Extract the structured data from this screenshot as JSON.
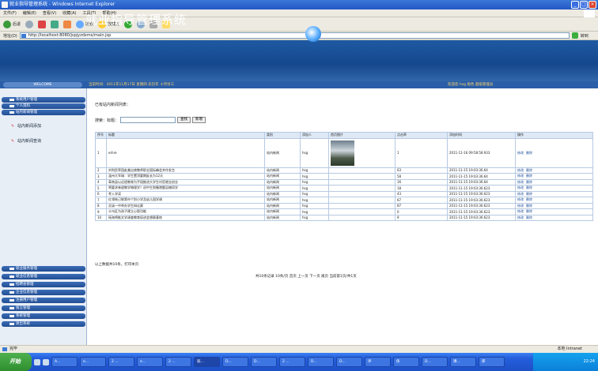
{
  "window": {
    "title": "就业指导管理系统 - Windows Internet Explorer"
  },
  "menu": [
    "文件(F)",
    "编辑(E)",
    "查看(V)",
    "收藏(A)",
    "工具(T)",
    "帮助(H)"
  ],
  "toolbar": {
    "back": "后退",
    "search": "搜索",
    "favorites": "收藏夹"
  },
  "address": {
    "label": "地址(D)",
    "url": "http://localhost:8080/jspjyzdxms/main.jsp",
    "go": "转到"
  },
  "banner": {
    "title": "就业指导管理系统"
  },
  "infobar": {
    "welcome": "WELCOME",
    "time": "当前时间：2011年11月17日 星期四 农历年 十月廿三",
    "user": "欢迎您 hsg 角色 超级管理员"
  },
  "sidebar": {
    "groups_top": [
      "系统用户管理",
      "个人资料",
      "站内新闻管理"
    ],
    "items": [
      "站内新闻添加",
      "站内新闻查询"
    ],
    "groups_bottom": [
      "就业服务管理",
      "就业信息管理",
      "招聘会管理",
      "企业信息管理",
      "注册用户管理",
      "留言管理",
      "系统管理",
      "退出系统"
    ]
  },
  "main": {
    "heading": "已有站内新闻列表：",
    "search_label": "搜索：标题：",
    "search_value": "",
    "search_button": "查找",
    "add_button": "新增",
    "columns": [
      "序号",
      "标题",
      "类别",
      "添加人",
      "首页图片",
      "点击率",
      "添加时间",
      "操作"
    ],
    "rows": [
      [
        "1",
        "erhre",
        "站内新闻",
        "hsg",
        "img",
        "1",
        "2011-11-16 09:58:58.933"
      ],
      [
        "2",
        "刘利民率团赴美出席教师职业国际峰会并作发言",
        "站内新闻",
        "hsg",
        "",
        "63",
        "2011-11-15 19:03:36.64"
      ],
      [
        "3",
        "温州大军瑞：学生置顶要期延长为12天",
        "站内新闻",
        "hsg",
        "",
        "58",
        "2011-11-15 19:03:36.64"
      ],
      [
        "4",
        "革南县以远程教育为手段推进大学生村官就业创业",
        "站内新闻",
        "hsg",
        "",
        "16",
        "2011-11-15 19:03:36.64"
      ],
      [
        "5",
        "将要求林斌教学物理学？初中生划撤港题吴楠同学",
        "站内新闻",
        "hsg",
        "",
        "18",
        "2011-11-15 19:03:36.623"
      ],
      [
        "6",
        "考入学读",
        "站内新闻",
        "hsg",
        "",
        "43",
        "2011-11-15 19:03:36.623"
      ],
      [
        "7",
        "红领帐己联第市个别小学及幼儿园学调",
        "站内新闻",
        "hsg",
        "",
        "67",
        "2011-11-15 19:03:36.623"
      ],
      [
        "8",
        "灵溪一中举办学生辩论赛",
        "站内新闻",
        "hsg",
        "",
        "87",
        "2011-11-15 19:03:36.623"
      ],
      [
        "9",
        "义乌区为孩子建立心智功能",
        "站内新闻",
        "hsg",
        "",
        "0",
        "2011-11-15 19:03:36.623"
      ],
      [
        "10",
        "瑶海将推文学调查教育现进会想赛基地",
        "站内新闻",
        "hsg",
        "",
        "9",
        "2011-11-15 19:03:36.623"
      ]
    ],
    "ops": [
      "修改",
      "删除"
    ],
    "footer": "以上数据共10条，打印本页",
    "pager": "共10条记录  10条/页  首页  上一页  下一页  尾页  当前第1页/共1页"
  },
  "status": {
    "left": "完毕",
    "zone": "本地 Intranet"
  },
  "taskbar": {
    "start": "开始",
    "tasks": [
      "A...",
      "e...",
      "2 ...",
      "e...",
      "2 ...",
      "就...",
      "D...",
      "D...",
      "2 ...",
      "D...",
      "D...",
      "评",
      "侠",
      "D...",
      "课...",
      "库"
    ],
    "clock": "22:24"
  },
  "colors": {
    "banner": "#1f5aa3",
    "sidebar_header": "#2a5ea8",
    "table_header": "#dfe9f6"
  }
}
